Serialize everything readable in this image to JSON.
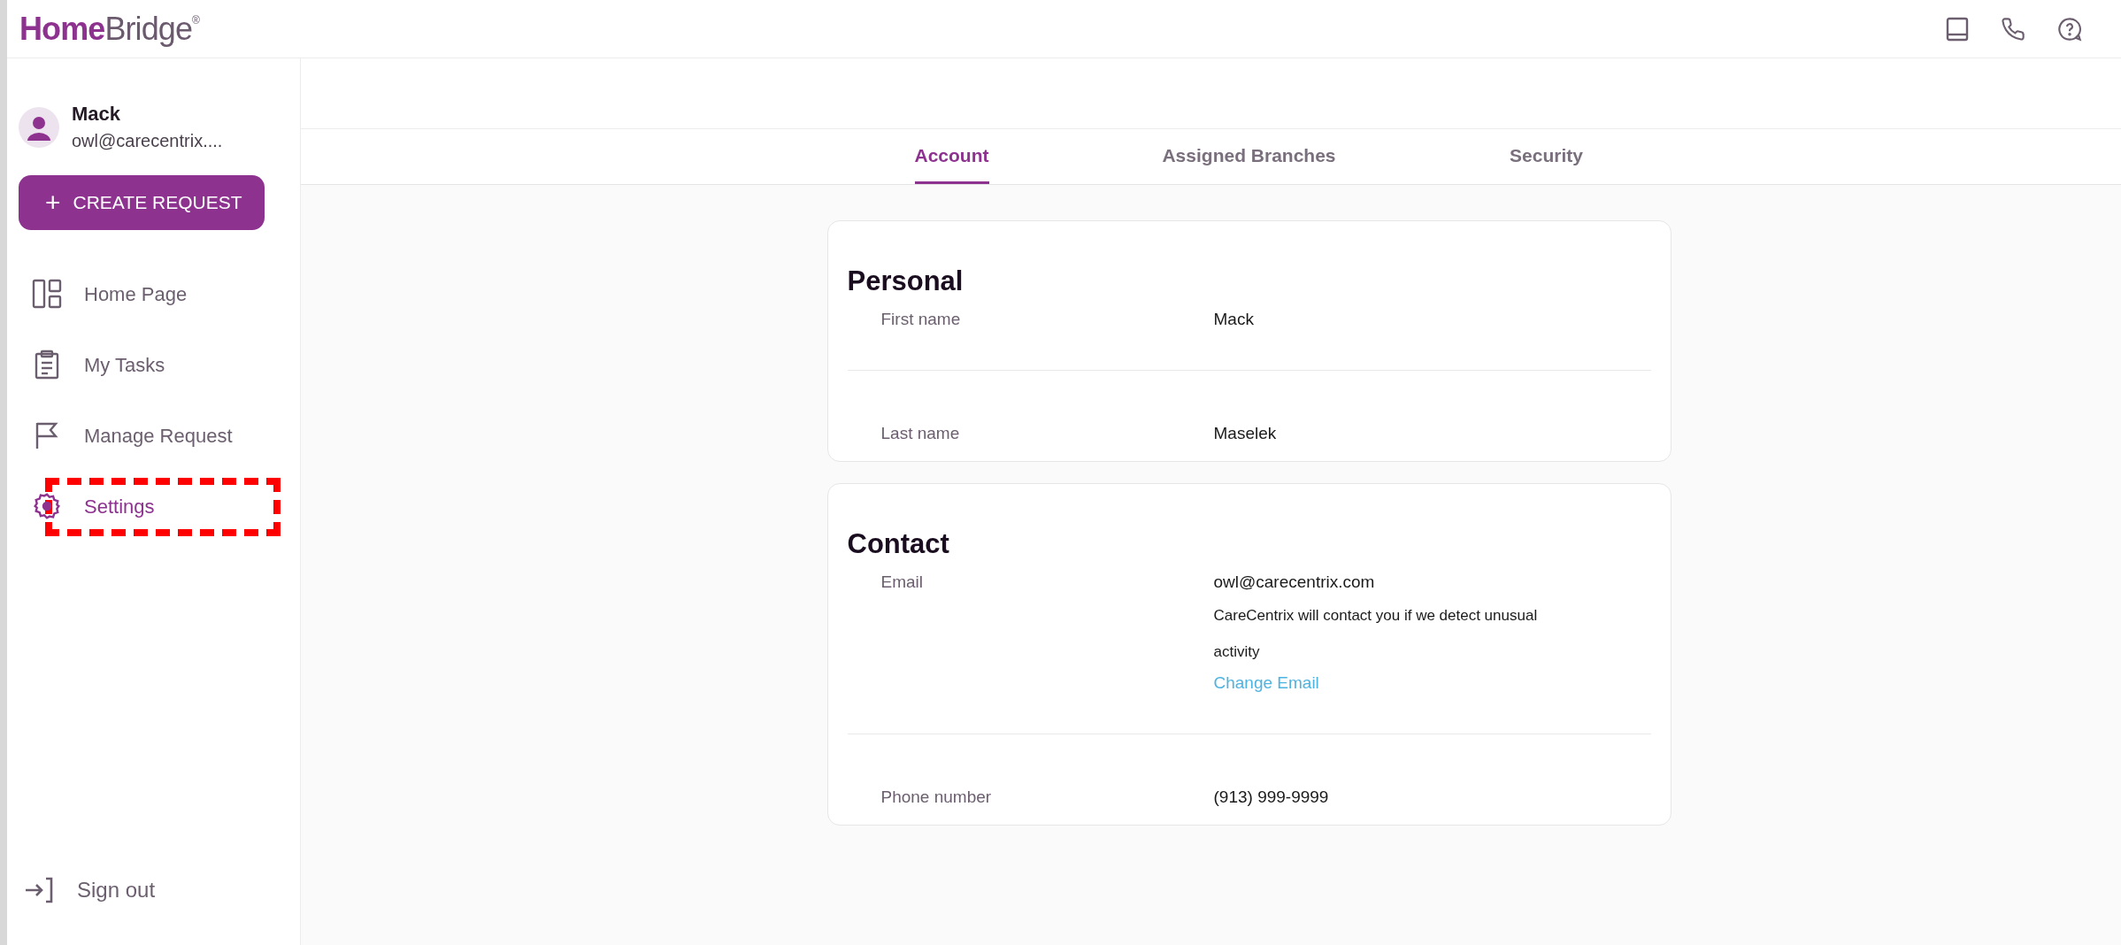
{
  "header": {
    "logo": {
      "part_1": "Home",
      "part_2": "Bridge",
      "mark": "®"
    }
  },
  "user": {
    "name": "Mack",
    "email": "owl@carecentrix...."
  },
  "create_button": {
    "icon": "+",
    "label": "CREATE REQUEST"
  },
  "nav": [
    {
      "kind": "dashboard",
      "label": "Home Page",
      "selected": false,
      "highlighted": false
    },
    {
      "kind": "clipboard",
      "label": "My Tasks",
      "selected": false,
      "highlighted": false
    },
    {
      "kind": "flag",
      "label": "Manage Request",
      "selected": false,
      "highlighted": false
    },
    {
      "kind": "gear",
      "label": "Settings",
      "selected": true,
      "highlighted": true
    }
  ],
  "sign_out": {
    "label": "Sign out"
  },
  "tabs": [
    {
      "label": "Account",
      "selected": true
    },
    {
      "label": "Assigned Branches",
      "selected": false
    },
    {
      "label": "Security",
      "selected": false
    }
  ],
  "sections": [
    {
      "title": "Personal",
      "rows": [
        {
          "label": "First name",
          "value": "Mack"
        },
        {
          "label": "Last name",
          "value": "Maselek"
        }
      ]
    },
    {
      "title": "Contact",
      "rows": [
        {
          "label": "Email",
          "value": "owl@carecentrix.com",
          "note": "CareCentrix will contact you if we detect unusual activity",
          "link": "Change Email"
        },
        {
          "label": "Phone number",
          "value": "(913) 999-9999"
        }
      ]
    }
  ]
}
